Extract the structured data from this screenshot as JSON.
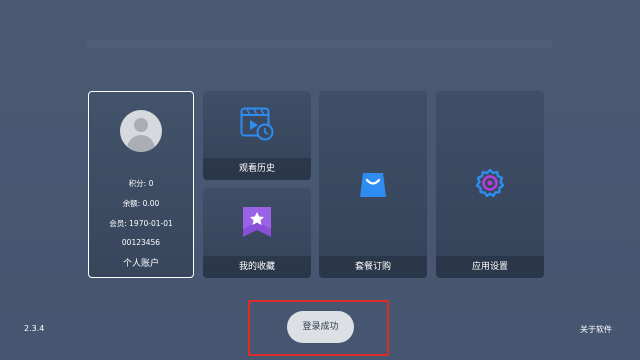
{
  "account": {
    "label": "个人账户",
    "points": "积分: 0",
    "balance": "余额: 0.00",
    "member": "会员: 1970-01-01",
    "id": "00123456"
  },
  "tiles": {
    "history": "观看历史",
    "favorites": "我的收藏",
    "subscription": "套餐订购",
    "settings": "应用设置"
  },
  "footer": {
    "version": "2.3.4",
    "login_status": "登录成功",
    "about": "关于软件"
  },
  "colors": {
    "icon_blue": "#2f8cf0",
    "icon_purple": "#8a4fd8",
    "highlight": "#e02a2a"
  }
}
